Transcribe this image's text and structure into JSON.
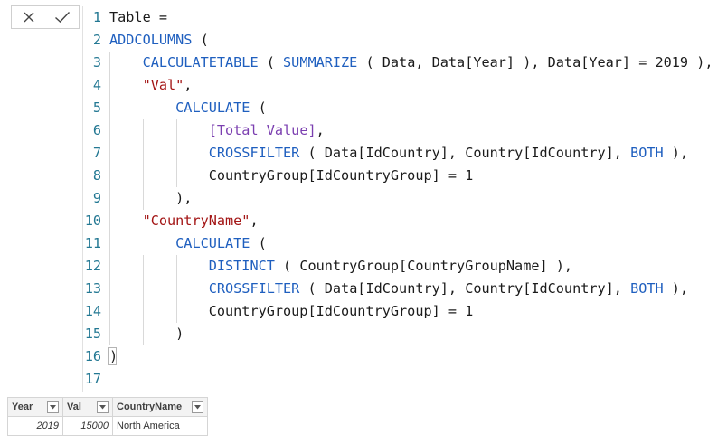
{
  "formula_bar": {
    "cancel_icon": "x-icon",
    "commit_icon": "check-icon",
    "lines": [
      {
        "n": "1",
        "tokens": [
          {
            "t": "Table =",
            "c": "plain"
          }
        ]
      },
      {
        "n": "2",
        "tokens": [
          {
            "t": "ADDCOLUMNS",
            "c": "kw"
          },
          {
            "t": " (",
            "c": "plain"
          }
        ]
      },
      {
        "n": "3",
        "tokens": [
          {
            "t": "    ",
            "c": "plain"
          },
          {
            "t": "CALCULATETABLE",
            "c": "kw"
          },
          {
            "t": " ( ",
            "c": "plain"
          },
          {
            "t": "SUMMARIZE",
            "c": "kw"
          },
          {
            "t": " ( Data, Data[Year] ), Data[Year] = 2019 ),",
            "c": "plain"
          }
        ]
      },
      {
        "n": "4",
        "tokens": [
          {
            "t": "    ",
            "c": "plain"
          },
          {
            "t": "\"Val\"",
            "c": "str"
          },
          {
            "t": ",",
            "c": "plain"
          }
        ]
      },
      {
        "n": "5",
        "tokens": [
          {
            "t": "        ",
            "c": "plain"
          },
          {
            "t": "CALCULATE",
            "c": "kw"
          },
          {
            "t": " (",
            "c": "plain"
          }
        ]
      },
      {
        "n": "6",
        "tokens": [
          {
            "t": "            ",
            "c": "plain"
          },
          {
            "t": "[Total Value]",
            "c": "meas"
          },
          {
            "t": ",",
            "c": "plain"
          }
        ]
      },
      {
        "n": "7",
        "tokens": [
          {
            "t": "            ",
            "c": "plain"
          },
          {
            "t": "CROSSFILTER",
            "c": "kw"
          },
          {
            "t": " ( Data[IdCountry], Country[IdCountry], ",
            "c": "plain"
          },
          {
            "t": "BOTH",
            "c": "kw"
          },
          {
            "t": " ),",
            "c": "plain"
          }
        ]
      },
      {
        "n": "8",
        "tokens": [
          {
            "t": "            CountryGroup[IdCountryGroup] = 1",
            "c": "plain"
          }
        ]
      },
      {
        "n": "9",
        "tokens": [
          {
            "t": "        ),",
            "c": "plain"
          }
        ]
      },
      {
        "n": "10",
        "tokens": [
          {
            "t": "    ",
            "c": "plain"
          },
          {
            "t": "\"CountryName\"",
            "c": "str"
          },
          {
            "t": ",",
            "c": "plain"
          }
        ]
      },
      {
        "n": "11",
        "tokens": [
          {
            "t": "        ",
            "c": "plain"
          },
          {
            "t": "CALCULATE",
            "c": "kw"
          },
          {
            "t": " (",
            "c": "plain"
          }
        ]
      },
      {
        "n": "12",
        "tokens": [
          {
            "t": "            ",
            "c": "plain"
          },
          {
            "t": "DISTINCT",
            "c": "kw"
          },
          {
            "t": " ( CountryGroup[CountryGroupName] ),",
            "c": "plain"
          }
        ]
      },
      {
        "n": "13",
        "tokens": [
          {
            "t": "            ",
            "c": "plain"
          },
          {
            "t": "CROSSFILTER",
            "c": "kw"
          },
          {
            "t": " ( Data[IdCountry], Country[IdCountry], ",
            "c": "plain"
          },
          {
            "t": "BOTH",
            "c": "kw"
          },
          {
            "t": " ),",
            "c": "plain"
          }
        ]
      },
      {
        "n": "14",
        "tokens": [
          {
            "t": "            CountryGroup[IdCountryGroup] = 1",
            "c": "plain"
          }
        ]
      },
      {
        "n": "15",
        "tokens": [
          {
            "t": "        )",
            "c": "plain"
          }
        ]
      },
      {
        "n": "16",
        "tokens": [
          {
            "t": ")",
            "c": "plain"
          }
        ]
      },
      {
        "n": "17",
        "tokens": []
      }
    ]
  },
  "table": {
    "columns": [
      "Year",
      "Val",
      "CountryName"
    ],
    "dropdown_icon": "chevron-down-icon",
    "rows": [
      [
        "2019",
        "15000",
        "North America"
      ]
    ]
  },
  "colors": {
    "keyword": "#1f5fbf",
    "string": "#a31515",
    "measure": "#7b3fb0",
    "line_number": "#237893"
  }
}
